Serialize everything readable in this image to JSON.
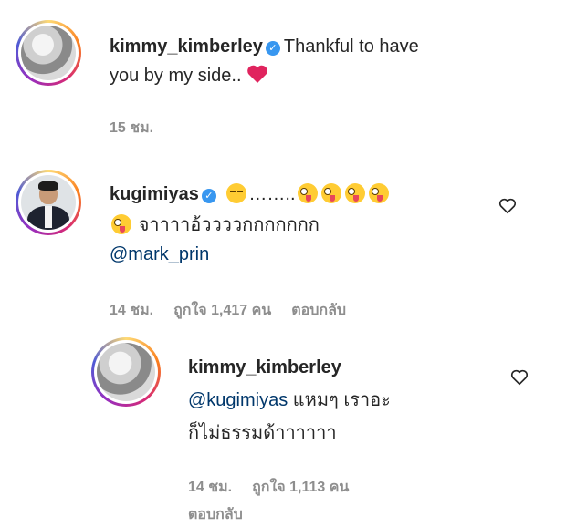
{
  "comments": [
    {
      "username": "kimmy_kimberley",
      "verified": true,
      "text": "Thankful to have",
      "text2": "you by my side..",
      "emoji": "heart",
      "time": "15 ชม."
    },
    {
      "username": "kugimiyas",
      "verified": true,
      "dots": "……..",
      "line2": "จาาาาอ้ววววกกกกกกก",
      "mention": "@mark_prin",
      "time": "14 ชม.",
      "likes": "ถูกใจ 1,417 คน",
      "reply": "ตอบกลับ"
    }
  ],
  "reply": {
    "username": "kimmy_kimberley",
    "mention": "@kugimiyas",
    "text": "แหมๆ เราอะ",
    "text2": "ก็ไม่ธรรมด้าาาาาา",
    "time": "14 ชม.",
    "likes": "ถูกใจ 1,113 คน",
    "reply_label": "ตอบกลับ"
  },
  "icons": {
    "verified": "verified-badge-icon",
    "like": "heart-outline-icon"
  },
  "colors": {
    "verified": "#3897f0",
    "heart": "#e0245e",
    "mention": "#00376b",
    "meta": "#8e8e8e"
  }
}
